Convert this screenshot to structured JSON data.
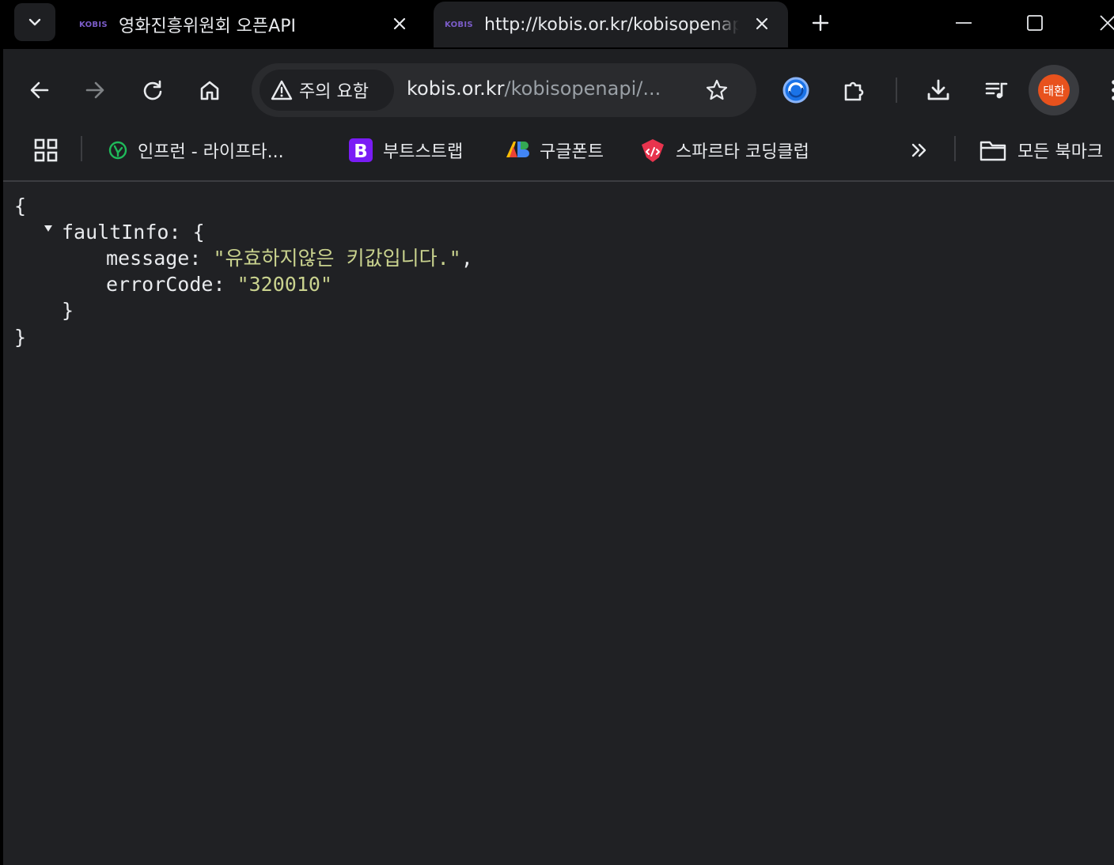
{
  "tabs": [
    {
      "favicon_text": "KOBIS",
      "title": "영화진흥위원회 오픈API",
      "active": false
    },
    {
      "favicon_text": "KOBIS",
      "title": "http://kobis.or.kr/kobisopenapi/webservice/rest/boxoffice",
      "active": true
    }
  ],
  "toolbar": {
    "security_label": "주의 요함",
    "url_host": "kobis.or.kr",
    "url_path": "/kobisopenapi/...",
    "profile_initials": "태환",
    "profile_color": "#e8521d"
  },
  "bookmarks": {
    "items": [
      {
        "label": "인프런 - 라이프타...",
        "icon": "inflearn-icon",
        "color": "#1fba5a"
      },
      {
        "label": "부트스트랩",
        "icon": "bootstrap-icon",
        "color": "#7a1cf5"
      },
      {
        "label": "구글폰트",
        "icon": "google-fonts-icon",
        "color": "#4285f4"
      },
      {
        "label": "스파르타 코딩클럽",
        "icon": "sparta-icon",
        "color": "#e8344e"
      }
    ],
    "all_bookmarks_label": "모든 북마크"
  },
  "json_viewer": {
    "open_brace": "{",
    "close_brace": "}",
    "key_root": "faultInfo",
    "key_message": "message",
    "value_message": "\"유효하지않은 키값입니다.\"",
    "key_errorcode": "errorCode",
    "value_errorcode": "\"320010\"",
    "string_color": "#c9d28e"
  }
}
